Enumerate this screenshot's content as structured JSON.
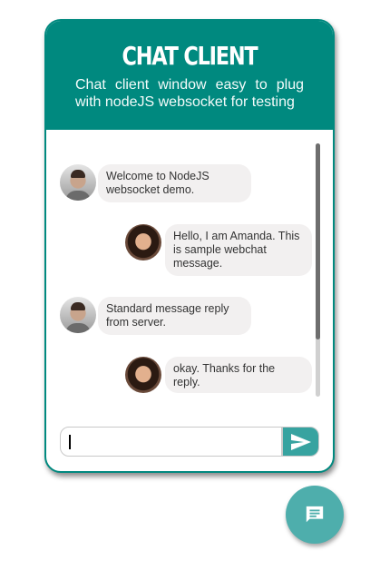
{
  "header": {
    "title": "CHAT CLIENT",
    "subtitle": "Chat client window easy to plug with nodeJS websocket for testing"
  },
  "messages": [
    {
      "sender": "server",
      "text": "Welcome to NodeJS websocket demo."
    },
    {
      "sender": "user",
      "text": "Hello, I am Amanda. This is sample webchat message."
    },
    {
      "sender": "server",
      "text": "Standard message reply from server."
    },
    {
      "sender": "user",
      "text": "okay. Thanks for the reply."
    }
  ],
  "composer": {
    "value": "",
    "send_icon": "send-icon"
  },
  "fab": {
    "icon": "chat-icon"
  },
  "colors": {
    "header": "#00897f",
    "send": "#37a3a0",
    "fab": "#4eaeac",
    "bubble": "#f2f0f0"
  }
}
